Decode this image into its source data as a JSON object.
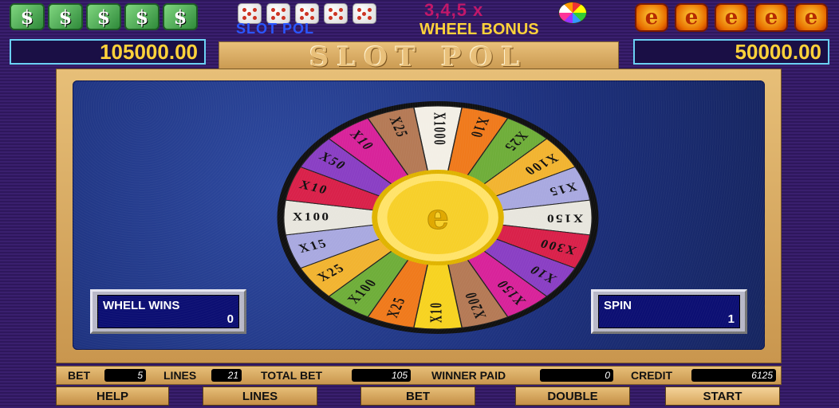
{
  "header": {
    "slot_pol_small": "SLOT POL",
    "multiplier_text": "3,4,5 x",
    "wheel_bonus": "WHEEL BONUS",
    "cash_icon_glyph": "$",
    "e_icon_glyph": "e",
    "left_balance": "105000.00",
    "right_balance": "50000.00",
    "title": "SLOT POL"
  },
  "wheel": {
    "center_glyph": "e",
    "segments": [
      {
        "label": "X1000",
        "color": "#f3efe6"
      },
      {
        "label": "X10",
        "color": "#f07a1c"
      },
      {
        "label": "X25",
        "color": "#6fae3a"
      },
      {
        "label": "X100",
        "color": "#f2b431"
      },
      {
        "label": "X15",
        "color": "#a9a9e0"
      },
      {
        "label": "X150",
        "color": "#e8e6de"
      },
      {
        "label": "X300",
        "color": "#d9214a"
      },
      {
        "label": "X10",
        "color": "#8a3fc4"
      },
      {
        "label": "X150",
        "color": "#d8239a"
      },
      {
        "label": "X200",
        "color": "#b57a56"
      },
      {
        "label": "X10",
        "color": "#f7d321"
      },
      {
        "label": "X25",
        "color": "#f07a1c"
      },
      {
        "label": "X100",
        "color": "#6fae3a"
      },
      {
        "label": "X25",
        "color": "#f2b431"
      },
      {
        "label": "X15",
        "color": "#a9a9e0"
      },
      {
        "label": "X100",
        "color": "#e8e6de"
      },
      {
        "label": "X10",
        "color": "#d9214a"
      },
      {
        "label": "X50",
        "color": "#8a3fc4"
      },
      {
        "label": "X10",
        "color": "#d8239a"
      },
      {
        "label": "X25",
        "color": "#b57a56"
      }
    ]
  },
  "panels": {
    "wins_label": "WHELL WINS",
    "wins_value": "0",
    "spin_label": "SPIN",
    "spin_value": "1"
  },
  "status": {
    "bet_label": "BET",
    "bet_value": "5",
    "lines_label": "LINES",
    "lines_value": "21",
    "total_bet_label": "TOTAL BET",
    "total_bet_value": "105",
    "winner_paid_label": "WINNER PAID",
    "winner_paid_value": "0",
    "credit_label": "CREDIT",
    "credit_value": "6125"
  },
  "buttons": {
    "help": "HELP",
    "lines": "LINES",
    "bet": "BET",
    "double": "DOUBLE",
    "start": "START"
  }
}
